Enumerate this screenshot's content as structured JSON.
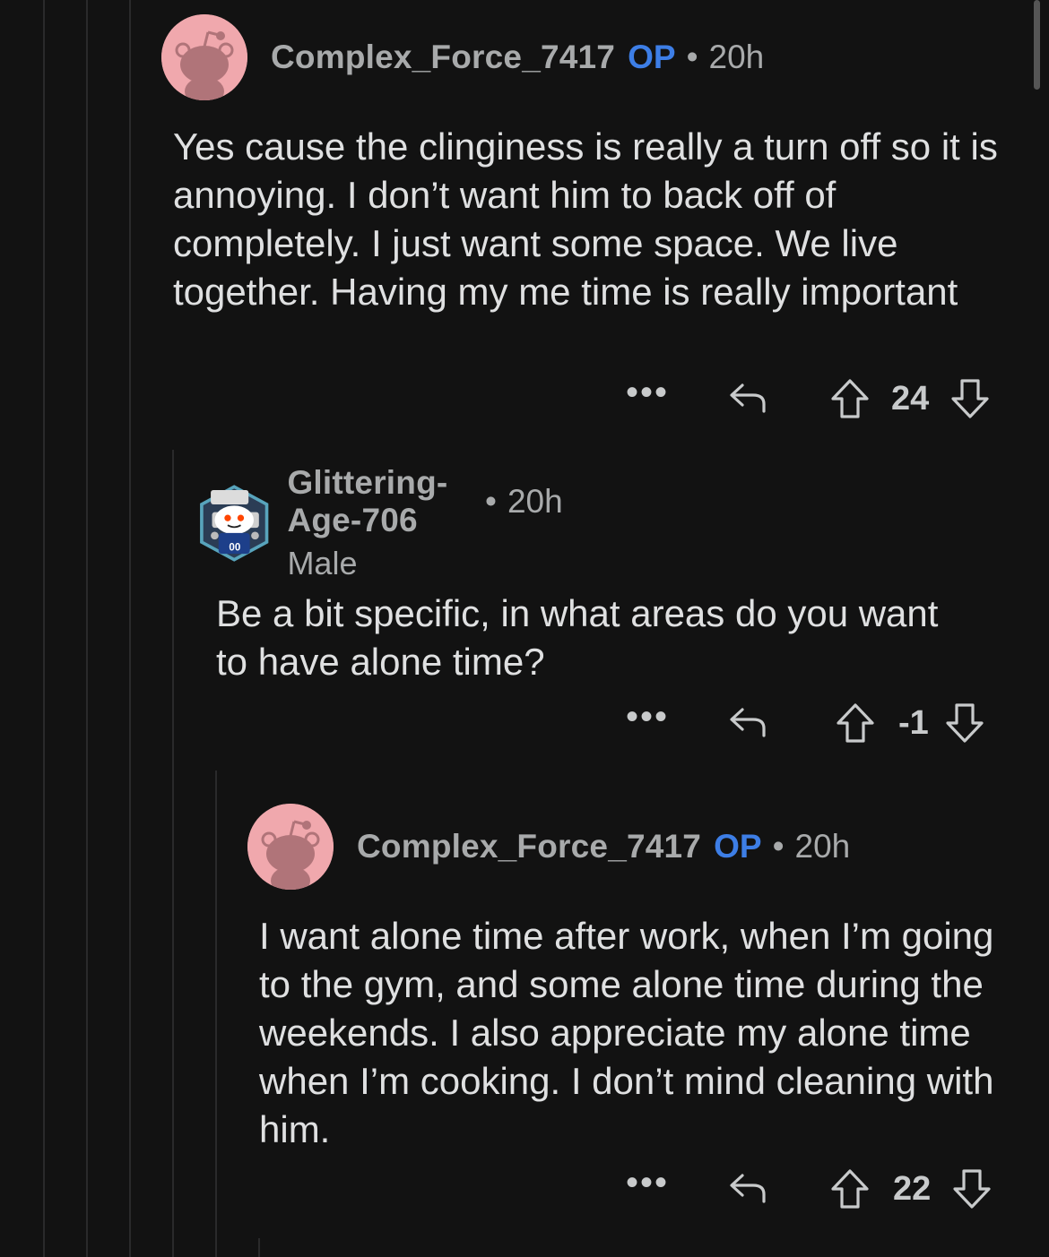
{
  "comments": [
    {
      "username": "Complex_Force_7417",
      "op_badge": "OP",
      "separator": "•",
      "time": "20h",
      "flair": "",
      "text": "Yes cause the clinginess is really a turn off so it is annoying. I don’t want him to back off of completely. I just want some space. We live together. Having my me time is really important",
      "more": "•••",
      "score": "24",
      "avatar": "snoo-pink-default"
    },
    {
      "username": "Glittering-Age-706",
      "op_badge": "",
      "separator": "•",
      "time": "20h",
      "flair": "Male",
      "text": "Be a bit specific, in what areas do you want to have alone time?",
      "more": "•••",
      "score": "-1",
      "avatar": "snoo-custom-blue"
    },
    {
      "username": "Complex_Force_7417",
      "op_badge": "OP",
      "separator": "•",
      "time": "20h",
      "flair": "",
      "text": "I want alone time after work, when I’m going to the gym, and some alone time during the weekends. I also appreciate my alone time when I’m cooking. I don’t mind cleaning with him.",
      "more": "•••",
      "score": "22",
      "avatar": "snoo-pink-default"
    }
  ],
  "colors": {
    "background": "#121212",
    "op": "#3d7ee6",
    "meta": "#a8aaab",
    "text": "#dfe0e1",
    "thread_line": "#2a2a2b"
  }
}
